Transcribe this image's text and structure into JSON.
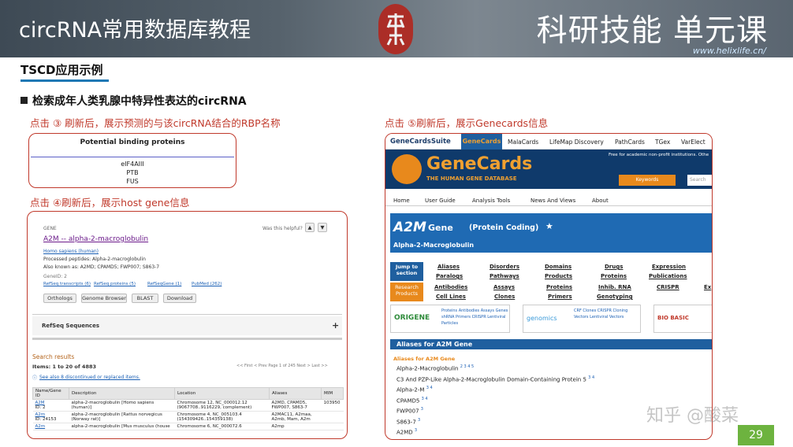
{
  "header": {
    "title": "circRNA常用数据库教程",
    "right_title": "科研技能 单元课",
    "url": "www.helixlife.cn/"
  },
  "section": {
    "title": "TSCD应用示例",
    "bullet": "检索成年人类乳腺中特异性表达的circRNA"
  },
  "captions": {
    "c1": "点击 ③ 刷新后，展示预测的与该circRNA结合的RBP名称",
    "c2": "点击 ④刷新后，展示host gene信息",
    "c3": "点击 ⑤刷新后，展示Genecards信息"
  },
  "binding": {
    "title": "Potential binding proteins",
    "items": [
      "eIF4AIII",
      "PTB",
      "FUS"
    ]
  },
  "ncbi": {
    "gene_label": "GENE",
    "helpful": "Was this helpful?",
    "gene_title": "A2M -- alpha-2-macroglobulin",
    "species": "Homo sapiens (human)",
    "processed": "Processed peptides: Alpha-2-macroglobulin",
    "aka": "Also known as: A2MD; CPAMD5; FWP007; S863-7",
    "geneid": "GeneID: 2",
    "links": [
      "RefSeq transcripts (6)",
      "RefSeq proteins (5)",
      "RefSeqGene (1)",
      "PubMed (262)"
    ],
    "buttons": [
      "Orthologs",
      "Genome Browser",
      "BLAST",
      "Download"
    ],
    "refseq": "RefSeq Sequences",
    "plus": "+",
    "results_title": "Search results",
    "results_range": "Items: 1 to 20 of 4883",
    "see_also": "See also 8 discontinued or replaced items.",
    "pager": "<< First  < Prev   Page  1  of 245   Next >   Last >>",
    "columns": [
      "Name/Gene ID",
      "Description",
      "Location",
      "Aliases",
      "MIM"
    ],
    "rows": [
      {
        "name": "A2M",
        "id": "ID: 2",
        "desc": "alpha-2-macroglobulin [Homo sapiens (human)]",
        "loc": "Chromosome 12, NC_000012.12 (9067708..9116229, complement)",
        "alias": "A2MD, CPAMD5, FWP007, S863-7",
        "mim": "103950"
      },
      {
        "name": "A2m",
        "id": "ID: 24153",
        "desc": "alpha-2-macroglobulin [Rattus norvegicus (Norway rat)]",
        "loc": "Chromosome 4, NC_005103.4 (154309426..154359138)",
        "alias": "A2MAC11, A2maa, A2mb, Mam, A2m",
        "mim": ""
      },
      {
        "name": "A2m",
        "id": "",
        "desc": "alpha-2-macroglobulin [Mus musculus (house",
        "loc": "Chromosome 6, NC_000072.6",
        "alias": "A2mp",
        "mim": ""
      }
    ]
  },
  "genecards": {
    "suite": "GeneCardsSuite",
    "tabs": [
      "GeneCards",
      "MalaCards",
      "LifeMap Discovery",
      "PathCards",
      "TGex",
      "VarElect"
    ],
    "logo": "GeneCards",
    "tagline": "THE HUMAN GENE DATABASE",
    "notice": "Free for academic non-profit institutions. Othe",
    "keywords": "Keywords",
    "search_ph": "Search",
    "menu": [
      "Home",
      "User Guide",
      "Analysis Tools",
      "News And Views",
      "About"
    ],
    "gene": "A2M",
    "gene_word": "Gene",
    "coding": "(Protein Coding)",
    "star": "★",
    "full": "Alpha-2-Macroglobulin",
    "jump": "Jump to section",
    "jump_links": [
      "Aliases",
      "Disorders",
      "Domains",
      "Drugs",
      "Expression",
      "Paralogs",
      "Pathways",
      "Products",
      "Proteins",
      "Publications"
    ],
    "research": "Research Products",
    "research_links": [
      "Antibodies",
      "Assays",
      "Proteins",
      "Inhib. RNA",
      "CRISPR",
      "Ex",
      "Cell Lines",
      "Clones",
      "Primers",
      "Genotyping"
    ],
    "ads": [
      {
        "logo": "ORIGENE",
        "text": "Proteins Antibodies Assays Genes shRNA Primers CRISPR Lentiviral Particles"
      },
      {
        "logo": "genomics",
        "text": "CRF Clones CRISPR Cloning Vectors Lentiviral Vectors"
      },
      {
        "logo": "BIO BASIC",
        "text": ""
      }
    ],
    "aliases_bar": "Aliases for A2M Gene",
    "aliases_head": "Aliases for A2M Gene",
    "aliases": [
      {
        "t": "Alpha-2-Macroglobulin",
        "s": "2 3 4 5"
      },
      {
        "t": "C3 And PZP-Like Alpha-2-Macroglobulin Domain-Containing Protein 5",
        "s": "3 4"
      },
      {
        "t": "Alpha-2-M",
        "s": "3 4"
      },
      {
        "t": "CPAMD5",
        "s": "3 4"
      },
      {
        "t": "FWP007",
        "s": "3"
      },
      {
        "t": "S863-7",
        "s": "3"
      },
      {
        "t": "A2MD",
        "s": "3"
      }
    ]
  },
  "watermark": "知乎 @酸菜",
  "page_number": "29"
}
